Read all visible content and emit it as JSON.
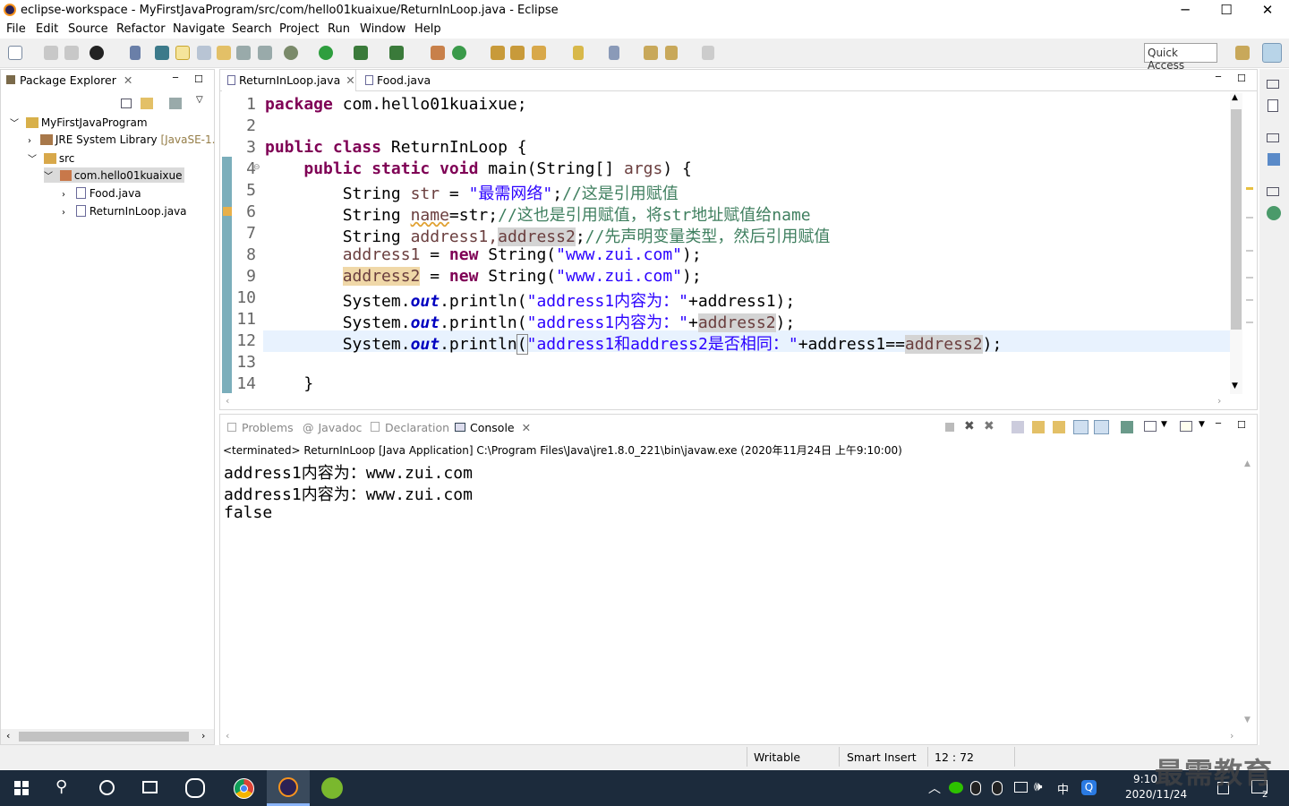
{
  "window": {
    "title": "eclipse-workspace - MyFirstJavaProgram/src/com/hello01kuaixue/ReturnInLoop.java - Eclipse",
    "minimize": "─",
    "maximize": "☐",
    "close": "✕"
  },
  "menu": [
    "File",
    "Edit",
    "Source",
    "Refactor",
    "Navigate",
    "Search",
    "Project",
    "Run",
    "Window",
    "Help"
  ],
  "toolbar": {
    "quick_access": "Quick Access"
  },
  "package_explorer": {
    "tab": "Package Explorer",
    "tree": [
      {
        "label": "MyFirstJavaProgram",
        "icon": "project-icon"
      },
      {
        "label": "JRE System Library",
        "suffix": "[JavaSE-1.",
        "icon": "library-icon"
      },
      {
        "label": "src",
        "icon": "folder-icon"
      },
      {
        "label": "com.hello01kuaixue",
        "icon": "package-icon"
      },
      {
        "label": "Food.java",
        "icon": "java-file-icon"
      },
      {
        "label": "ReturnInLoop.java",
        "icon": "java-file-icon"
      }
    ]
  },
  "editor": {
    "tabs": [
      {
        "label": "ReturnInLoop.java",
        "active": true
      },
      {
        "label": "Food.java",
        "active": false
      }
    ],
    "line_numbers": [
      "1",
      "2",
      "3",
      "4",
      "5",
      "6",
      "7",
      "8",
      "9",
      "10",
      "11",
      "12",
      "13",
      "14"
    ],
    "lines": {
      "l1_kw": "package",
      "l1_rest": " com.hello01kuaixue;",
      "l3_kw": "public class",
      "l3_rest": " ReturnInLoop {",
      "l4_kw": "public static void",
      "l4_rest": " main(String[] ",
      "l4_args": "args",
      "l4_end": ") {",
      "l5_type": "String ",
      "l5_var": "str",
      "l5_eq": " = ",
      "l5_str": "\"最需网络\"",
      "l5_semi": ";",
      "l5_cm": "//这是引用赋值",
      "l6_type": "String ",
      "l6_var": "name",
      "l6_mid": "=str;",
      "l6_cm": "//这也是引用赋值，将str地址赋值给name",
      "l7_type": "String ",
      "l7_a": "address1,",
      "l7_b": "address2",
      "l7_semi": ";",
      "l7_cm": "//先声明变量类型，然后引用赋值",
      "l8_var": "address1",
      "l8_eq": " = ",
      "l8_new": "new",
      "l8_call": " String(",
      "l8_str": "\"www.zui.com\"",
      "l8_end": ");",
      "l9_var": "address2",
      "l9_eq": " = ",
      "l9_new": "new",
      "l9_call": " String(",
      "l9_str": "\"www.zui.com\"",
      "l9_end": ");",
      "l10_a": "System.",
      "l10_out": "out",
      "l10_b": ".println(",
      "l10_str": "\"address1内容为：\"",
      "l10_c": "+address1);",
      "l11_a": "System.",
      "l11_out": "out",
      "l11_b": ".println(",
      "l11_str": "\"address1内容为：\"",
      "l11_c": "+",
      "l11_var": "address2",
      "l11_end": ");",
      "l12_a": "System.",
      "l12_out": "out",
      "l12_b": ".println",
      "l12_paren": "(",
      "l12_str": "\"address1和address2是否相同：\"",
      "l12_c": "+address1==",
      "l12_var": "address2",
      "l12_end": ");",
      "l14": "}"
    }
  },
  "console_view": {
    "tabs": [
      "Problems",
      "Javadoc",
      "Declaration",
      "Console"
    ],
    "header": "<terminated> ReturnInLoop [Java Application] C:\\Program Files\\Java\\jre1.8.0_221\\bin\\javaw.exe (2020年11月24日 上午9:10:00)",
    "output": [
      "address1内容为：www.zui.com",
      "address1内容为：www.zui.com",
      "false"
    ]
  },
  "status": {
    "writable": "Writable",
    "insert_mode": "Smart Insert",
    "position": "12 : 72"
  },
  "taskbar": {
    "time": "9:10",
    "date": "2020/11/24",
    "ime": "中",
    "notifications": "2",
    "watermark": "最需教育"
  }
}
